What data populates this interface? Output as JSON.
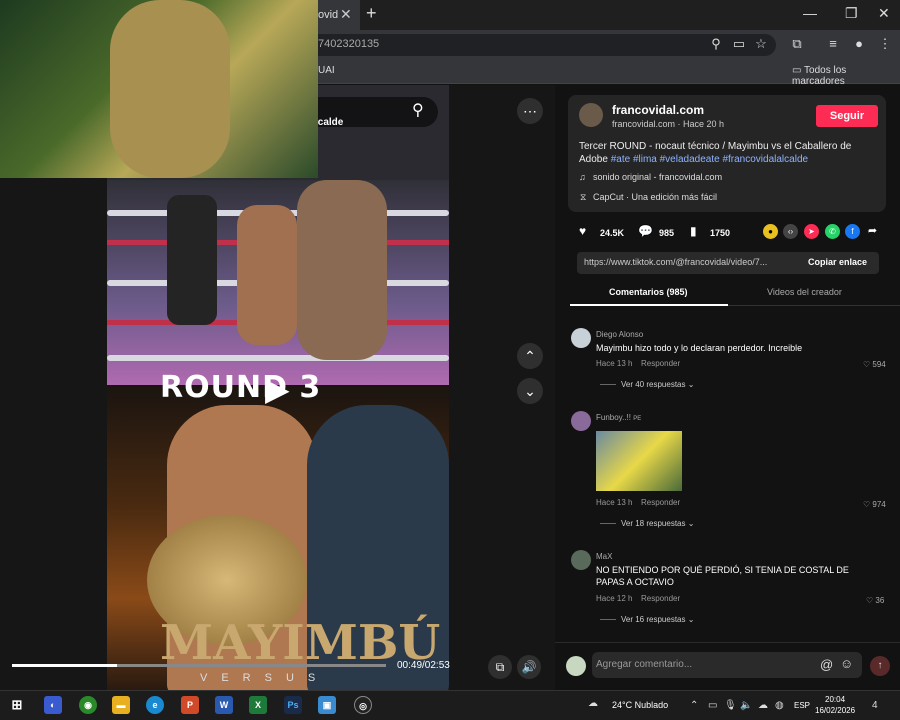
{
  "browser": {
    "tab_title": "ovid",
    "url": "7402320135",
    "bookmark": "UAI",
    "bookmarks_all": "Todos los marcadores"
  },
  "video": {
    "search_overlay_text": "lcalde",
    "overlay_round": "ROUND 3",
    "poster_title": "MAYIMBÚ",
    "poster_versus": "VERSUS",
    "time": "00:49/02:53",
    "progress": 0.28
  },
  "post": {
    "author": "francovidal.com",
    "handle": "francovidal.com · Hace 20 h",
    "follow_label": "Seguir",
    "description": "Tercer ROUND - nocaut técnico / Mayimbu vs el Caballero de Adobe",
    "hashtags": "#ate #lima #veladadeate #francovidalalcalde",
    "sound": "sonido original - francovidal.com",
    "capcut": "CapCut · Una edición más fácil",
    "likes": "24.5K",
    "comments": "985",
    "saves": "1750",
    "link": "https://www.tiktok.com/@francovidal/video/7...",
    "copy_label": "Copiar enlace"
  },
  "tabs": {
    "comments": "Comentarios (985)",
    "creator_videos": "Videos del creador"
  },
  "comments": [
    {
      "user": "Diego Alonso",
      "text": "Mayimbu hizo todo y lo declaran perdedor. Increible",
      "time": "Hace 13 h",
      "reply": "Responder",
      "likes": "594",
      "more": "Ver 40 respuestas"
    },
    {
      "user": "Funboy..!!",
      "badge": "PE",
      "text": "",
      "time": "Hace 13 h",
      "reply": "Responder",
      "likes": "974",
      "more": "Ver 18 respuestas"
    },
    {
      "user": "MaX",
      "text": "NO ENTIENDO POR QUÉ PERDIÓ, SI TENIA DE COSTAL DE PAPAS A OCTAVIO",
      "time": "Hace 12 h",
      "reply": "Responder",
      "likes": "36",
      "more": "Ver 16 respuestas"
    }
  ],
  "compose": {
    "placeholder": "Agregar comentario..."
  },
  "taskbar": {
    "weather": "24°C  Nublado",
    "lang": "ESP",
    "time": "20:04",
    "date": "16/02/2026",
    "notifications": "4"
  },
  "colors": {
    "accent": "#fe2c55",
    "hashtag": "#8fb4ff"
  }
}
